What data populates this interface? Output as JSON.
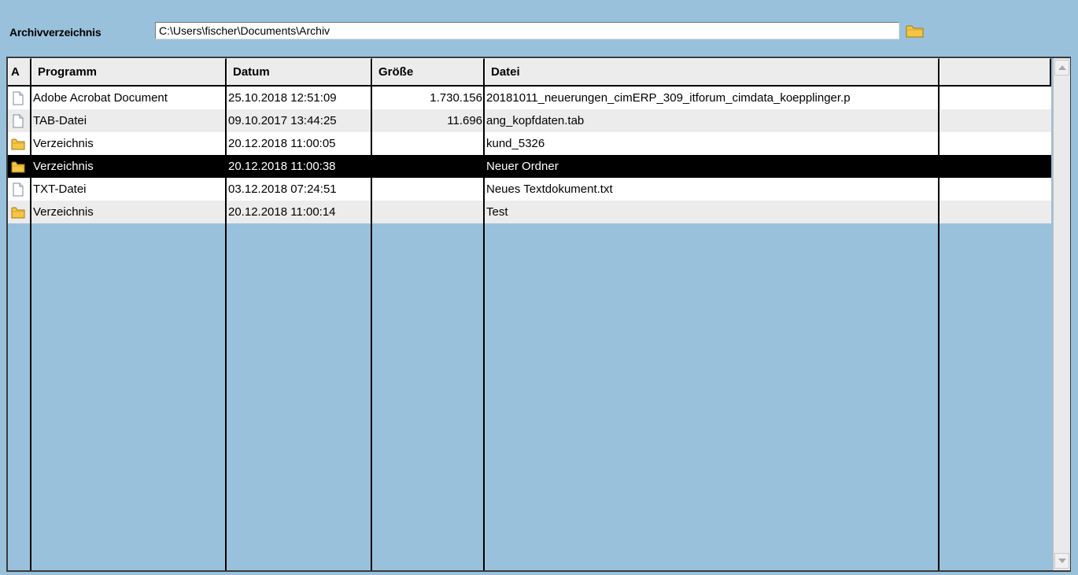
{
  "toolbar": {
    "label": "Archivverzeichnis",
    "path_value": "C:\\Users\\fischer\\Documents\\Archiv",
    "browse_icon": "folder-icon"
  },
  "columns": [
    "A",
    "Programm",
    "Datum",
    "Größe",
    "Datei",
    ""
  ],
  "rows": [
    {
      "icon": "document-icon",
      "programm": "Adobe Acrobat Document",
      "datum": "25.10.2018 12:51:09",
      "groesse": "1.730.156",
      "datei": "20181011_neuerungen_cimERP_309_itforum_cimdata_koepplinger.p"
    },
    {
      "icon": "document-icon",
      "programm": "TAB-Datei",
      "datum": "09.10.2017 13:44:25",
      "groesse": "11.696",
      "datei": "ang_kopfdaten.tab"
    },
    {
      "icon": "folder-icon",
      "programm": "Verzeichnis",
      "datum": "20.12.2018 11:00:05",
      "groesse": "",
      "datei": "kund_5326"
    },
    {
      "icon": "folder-icon",
      "programm": "Verzeichnis",
      "datum": "20.12.2018 11:00:38",
      "groesse": "",
      "datei": "Neuer Ordner",
      "selected": true
    },
    {
      "icon": "document-icon",
      "programm": "TXT-Datei",
      "datum": "03.12.2018 07:24:51",
      "groesse": "",
      "datei": "Neues Textdokument.txt"
    },
    {
      "icon": "folder-icon",
      "programm": "Verzeichnis",
      "datum": "20.12.2018 11:00:14",
      "groesse": "",
      "datei": "Test"
    }
  ],
  "colors": {
    "background": "#99c1dc",
    "selection": "#000000",
    "row_alt": "#ececec",
    "folder": "#f5c545"
  }
}
